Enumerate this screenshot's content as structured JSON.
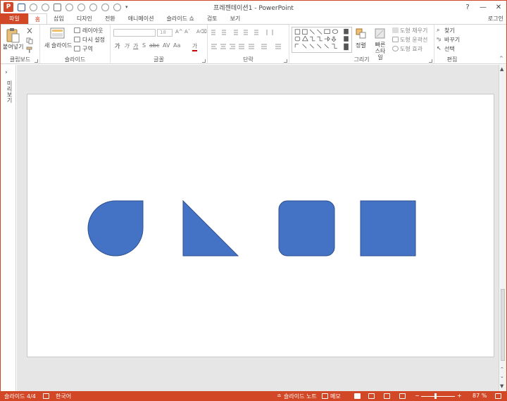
{
  "window": {
    "title": "프레젠테이션1 - PowerPoint",
    "app_icon_letter": "P",
    "controls": {
      "help": "?",
      "minimize": "—",
      "close": "✕"
    }
  },
  "tabs": [
    {
      "label": "파일"
    },
    {
      "label": "홈"
    },
    {
      "label": "삽입"
    },
    {
      "label": "디자인"
    },
    {
      "label": "전환"
    },
    {
      "label": "애니메이션"
    },
    {
      "label": "슬라이드 쇼"
    },
    {
      "label": "검토"
    },
    {
      "label": "보기"
    }
  ],
  "account": {
    "login_label": "로그인"
  },
  "ribbon": {
    "clipboard": {
      "label": "클립보드",
      "paste_label": "붙여넣기"
    },
    "slides": {
      "label": "슬라이드",
      "new_slide_label": "새 슬라이드",
      "layout_label": "레이아웃",
      "reset_label": "다시 설정",
      "section_label": "구역"
    },
    "font": {
      "label": "글꼴",
      "font_size": "18"
    },
    "paragraph": {
      "label": "단락"
    },
    "drawing": {
      "label": "그리기",
      "arrange_label": "정렬",
      "quick_styles_label": "빠른 스타일",
      "shape_fill_label": "도형 채우기",
      "shape_outline_label": "도형 윤곽선",
      "shape_effects_label": "도형 효과"
    },
    "editing": {
      "label": "편집",
      "find_label": "찾기",
      "replace_label": "바꾸기",
      "select_label": "선택"
    }
  },
  "left_panel": {
    "collapse_arrow": "›",
    "outline_label": "미리보기"
  },
  "slide": {
    "shapes": [
      {
        "type": "teardrop",
        "color": "#4472c4"
      },
      {
        "type": "right-triangle",
        "color": "#4472c4"
      },
      {
        "type": "rounded-rectangle",
        "color": "#4472c4"
      },
      {
        "type": "rectangle",
        "color": "#4472c4"
      }
    ]
  },
  "status": {
    "slide_indicator": "슬라이드 4/4",
    "language": "한국어",
    "notes_label": "슬라이드 노트",
    "comments_label": "메모",
    "zoom_percent": "87 %",
    "zoom_value": 87
  },
  "colors": {
    "accent": "#d24726",
    "shape_fill": "#4472c4",
    "shape_stroke": "#2f528f"
  }
}
